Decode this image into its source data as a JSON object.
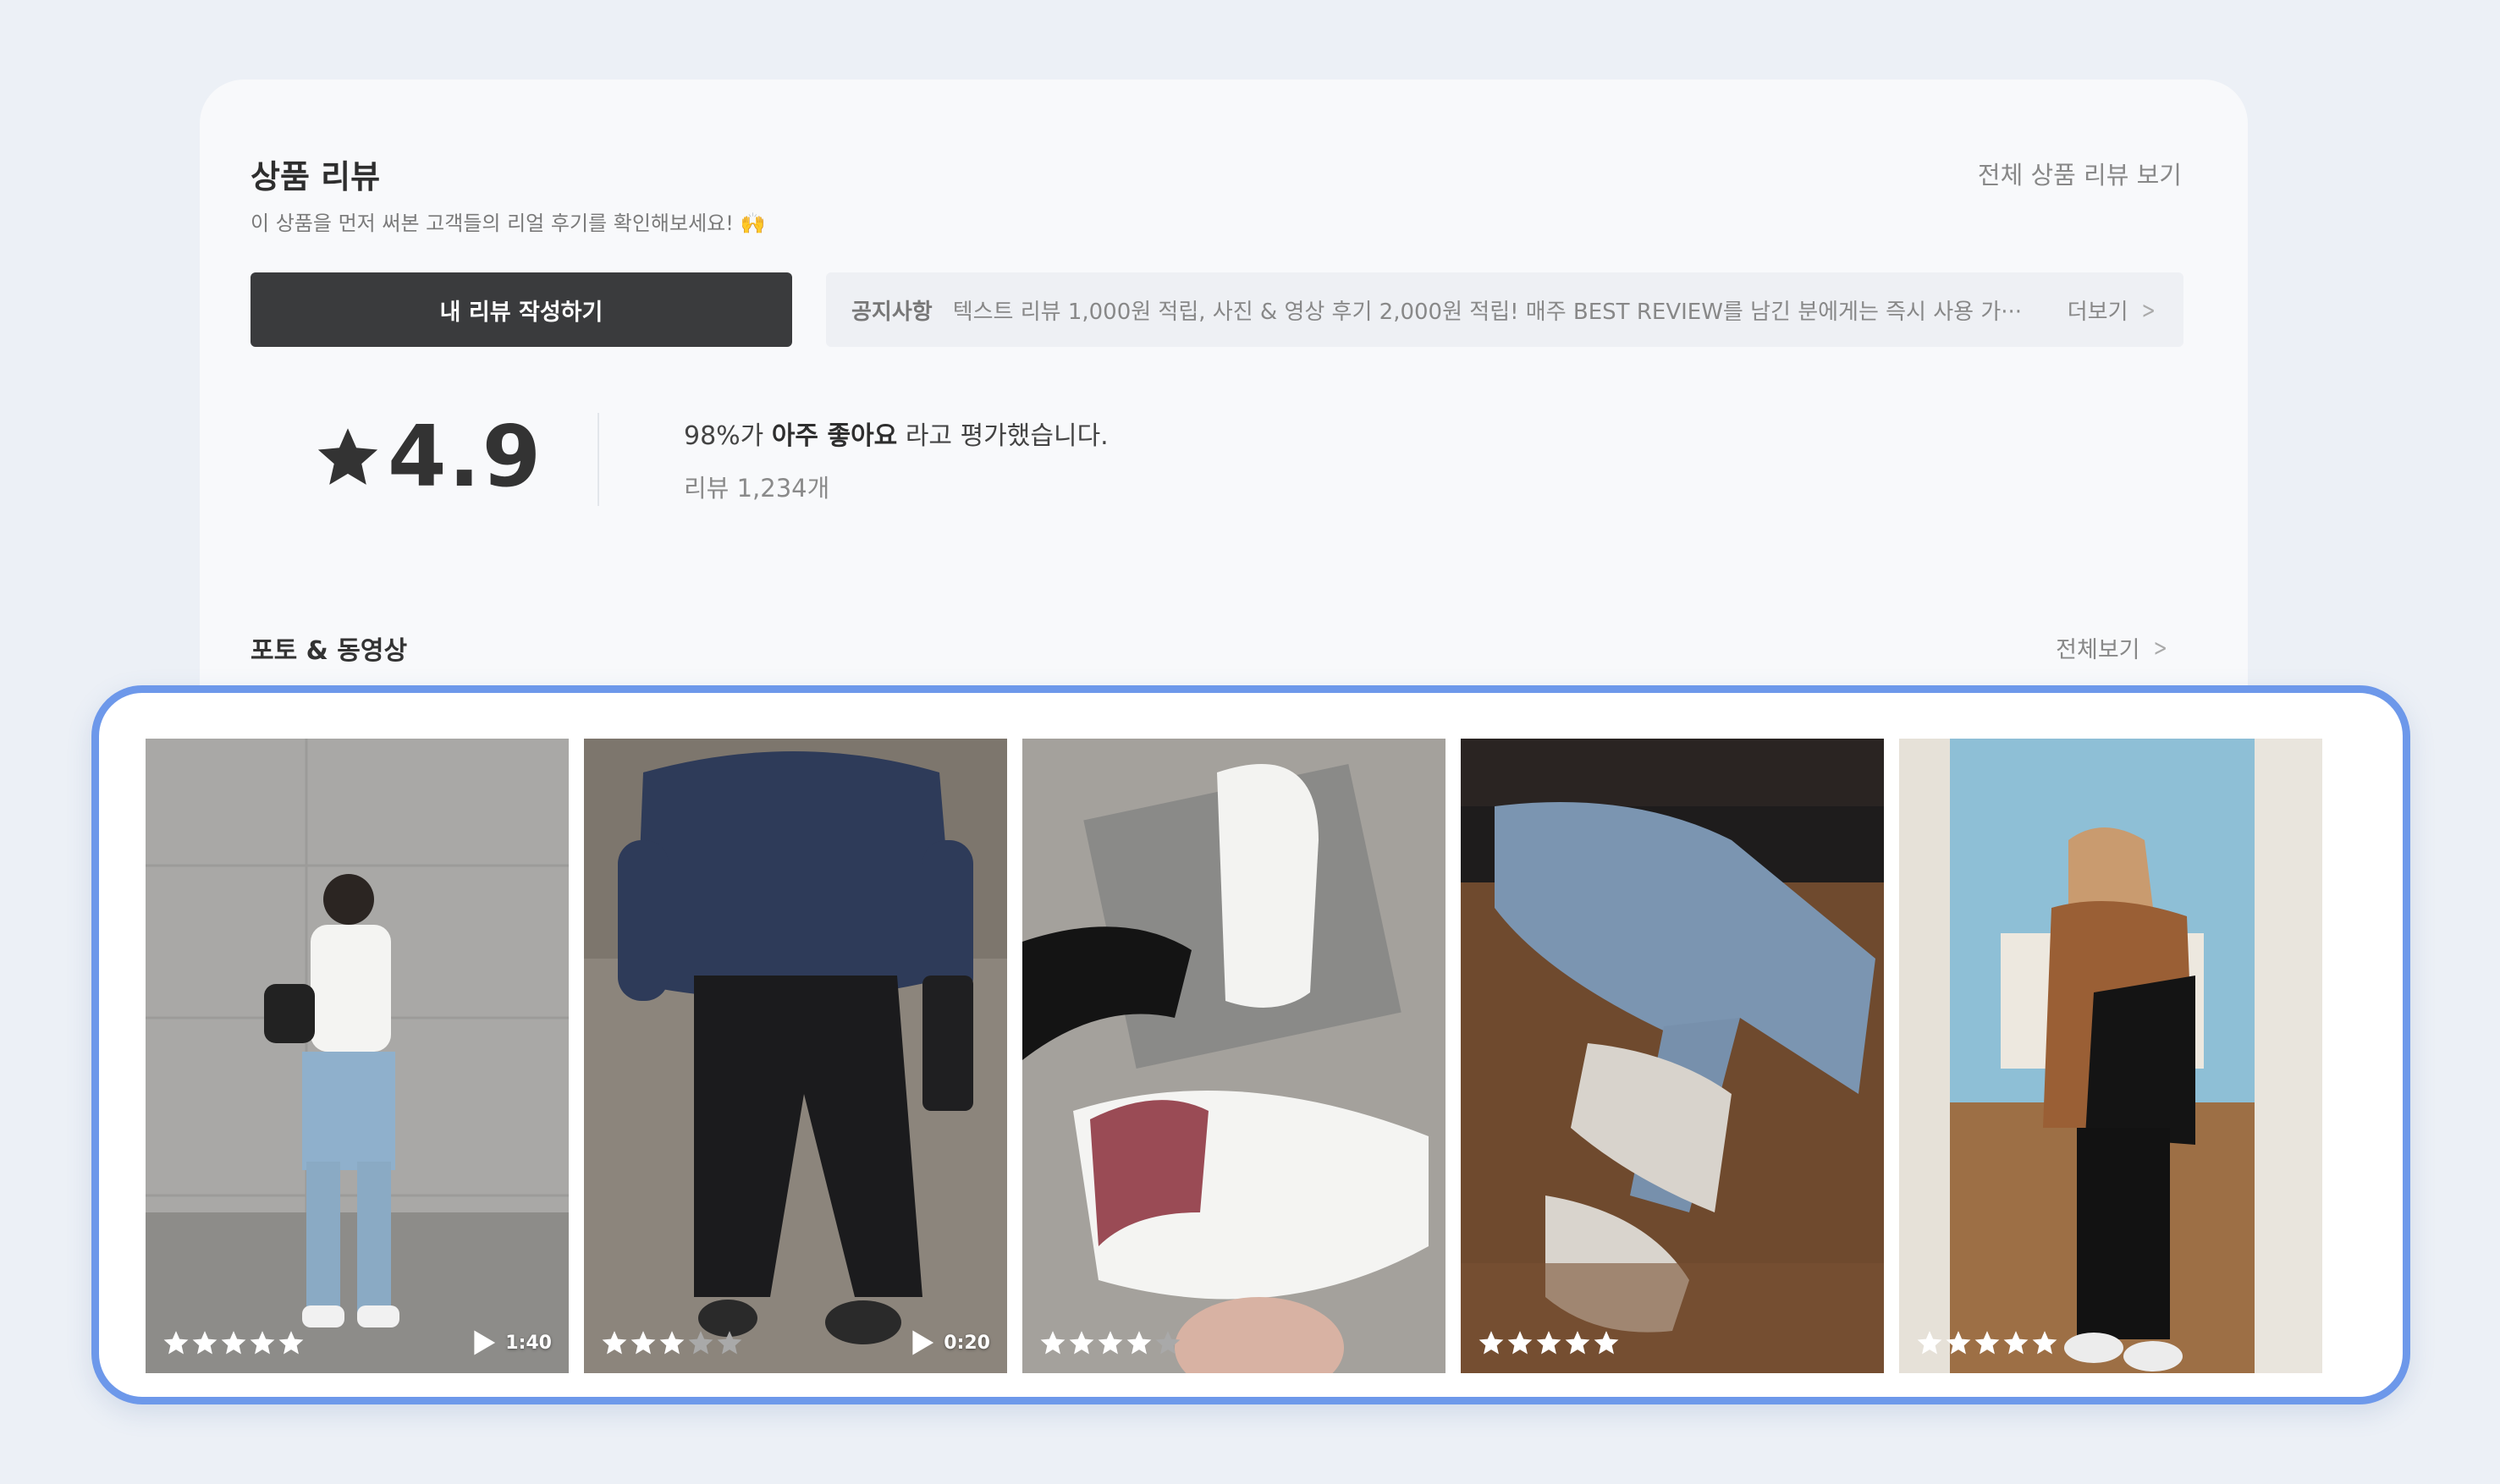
{
  "header": {
    "title": "상품 리뷰",
    "subtitle": "이 상품을 먼저 써본 고객들의 리얼 후기를 확인해보세요! 🙌",
    "view_all": "전체 상품 리뷰 보기"
  },
  "write_button": "내 리뷰 작성하기",
  "notice": {
    "label": "공지사항",
    "text": "텍스트 리뷰 1,000원 적립, 사진 & 영상 후기 2,000원 적립! 매주 BEST REVIEW를 남긴 분에게는 즉시 사용 가···",
    "more": "더보기"
  },
  "summary": {
    "rating": "4.9",
    "percent": "98%가",
    "highlight": "아주 좋아요",
    "suffix": "라고 평가했습니다.",
    "review_count": "리뷰 1,234개"
  },
  "photo_section": {
    "title": "포토 & 동영상",
    "view_all": "전체보기"
  },
  "colors": {
    "accent_border": "#6d98ea",
    "button_bg": "#3a3b3d",
    "star_filled": "#ffffff",
    "star_empty": "#a9a9a9"
  },
  "photos": [
    {
      "rating": 5,
      "duration": "1:40",
      "scene": "person-gray-wall"
    },
    {
      "rating": 3,
      "duration": "0:20",
      "scene": "person-navy-sweater"
    },
    {
      "rating": 4,
      "duration": "",
      "scene": "white-sneakers"
    },
    {
      "rating": 5,
      "duration": "",
      "scene": "jeans-chunky-sneakers"
    },
    {
      "rating": 5,
      "duration": "",
      "scene": "mirror-selfie"
    }
  ]
}
